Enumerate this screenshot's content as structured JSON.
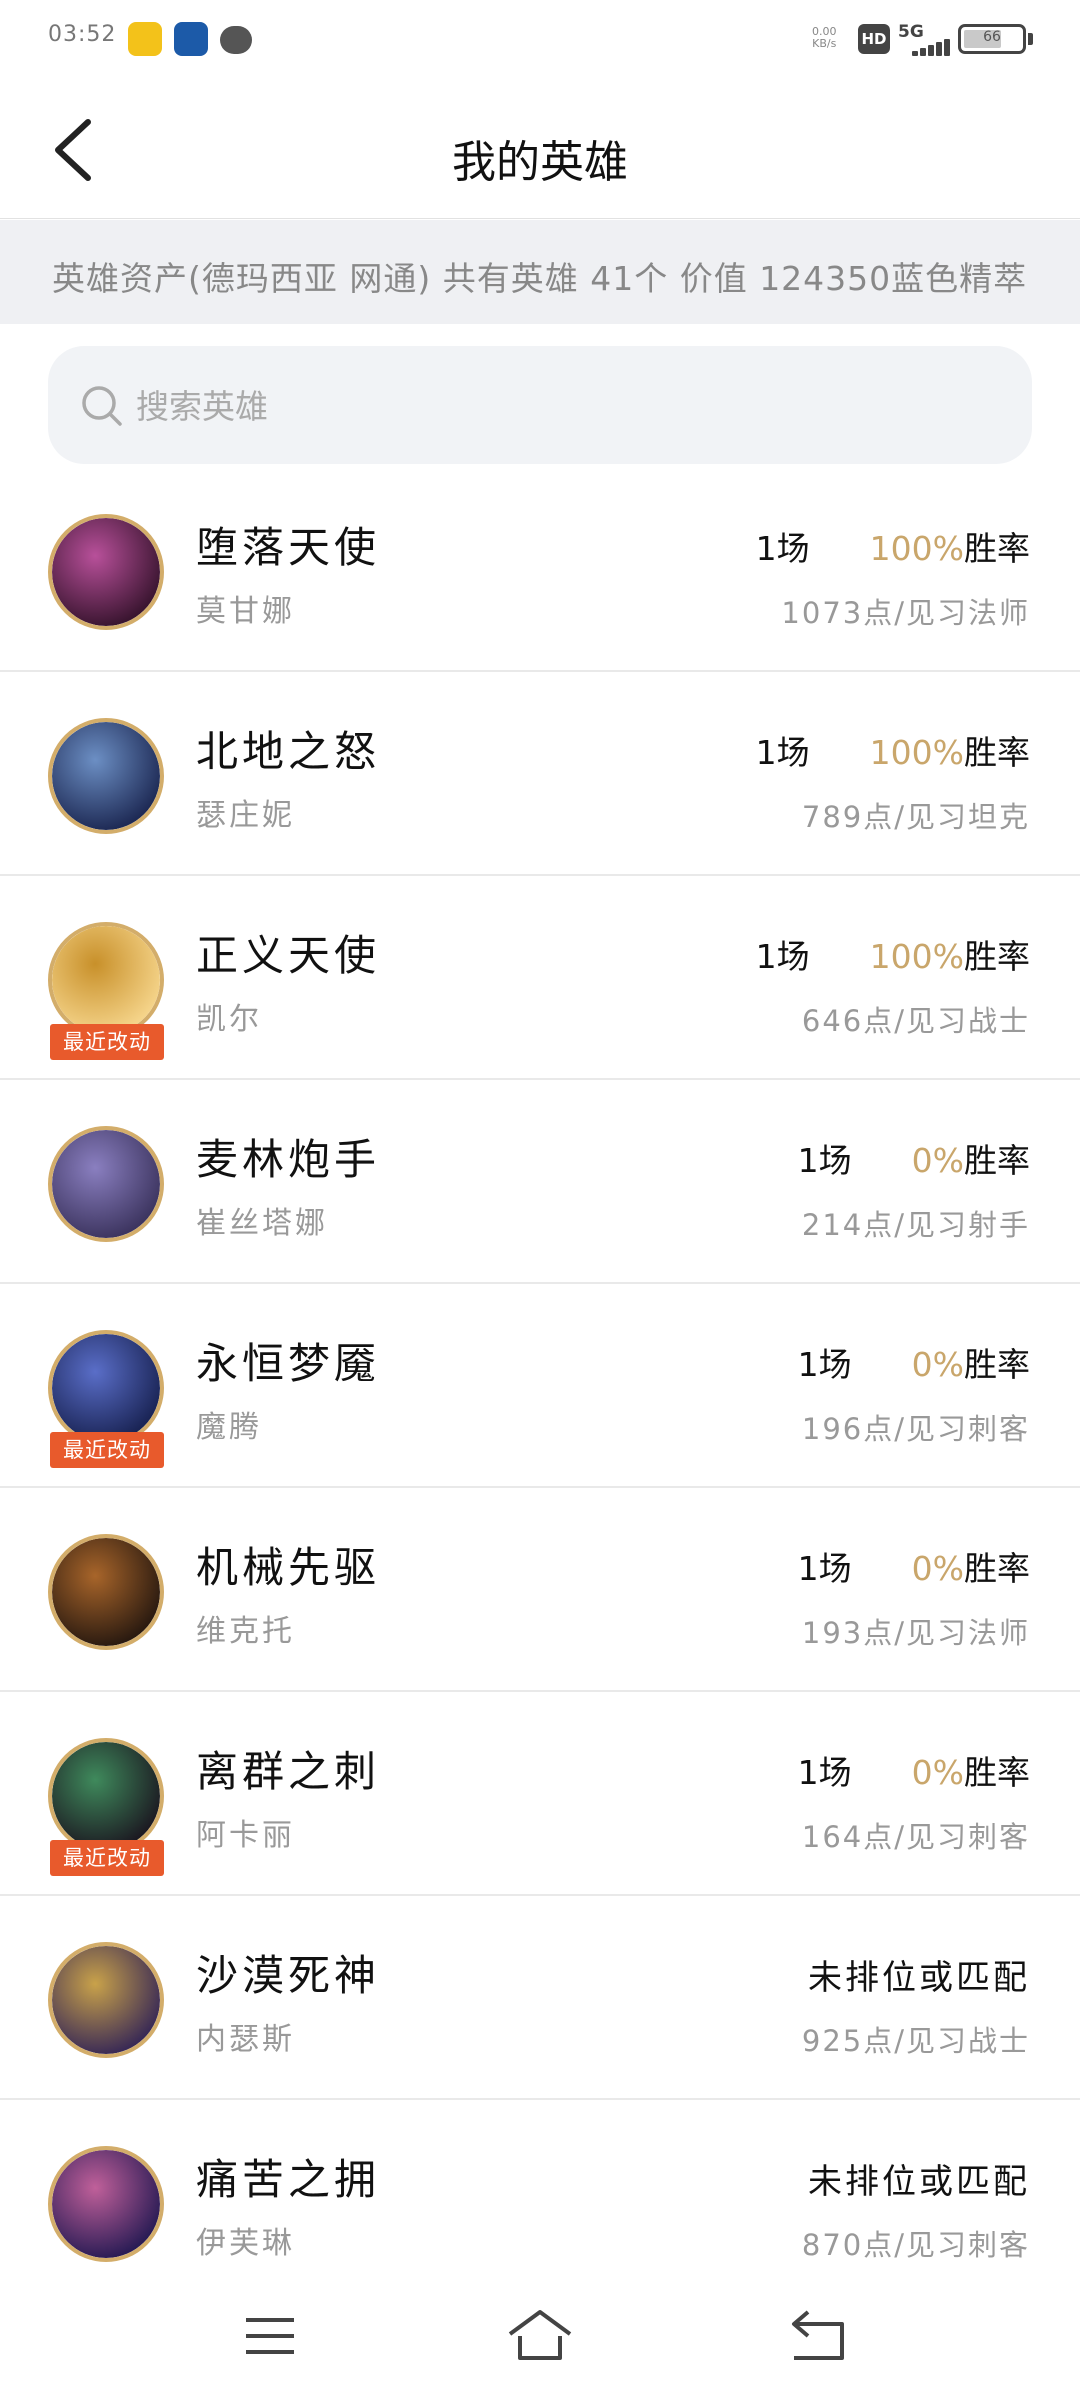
{
  "status_bar": {
    "time": "03:52",
    "net_speed_top": "0.00",
    "net_speed_bottom": "KB/s",
    "hd": "HD",
    "network": "5G",
    "battery": "66"
  },
  "header": {
    "title": "我的英雄",
    "back_icon": "chevron-left-icon"
  },
  "summary": {
    "text": "英雄资产(德玛西亚 网通) 共有英雄 41个 价值 124350蓝色精萃"
  },
  "search": {
    "placeholder": "搜索英雄",
    "value": ""
  },
  "heroes": [
    {
      "title": "堕落天使",
      "name": "莫甘娜",
      "games": "1场",
      "rate": "100%",
      "rate_label": "胜率",
      "points": "1073点/见习法师",
      "badge": "",
      "colors": [
        "#3a1530",
        "#b8509a"
      ]
    },
    {
      "title": "北地之怒",
      "name": "瑟庄妮",
      "games": "1场",
      "rate": "100%",
      "rate_label": "胜率",
      "points": "789点/见习坦克",
      "badge": "",
      "colors": [
        "#1e2a55",
        "#6c8fc4"
      ]
    },
    {
      "title": "正义天使",
      "name": "凯尔",
      "games": "1场",
      "rate": "100%",
      "rate_label": "胜率",
      "points": "646点/见习战士",
      "badge": "最近改动",
      "colors": [
        "#f5d48a",
        "#c8902a"
      ]
    },
    {
      "title": "麦林炮手",
      "name": "崔丝塔娜",
      "games": "1场",
      "rate": "0%",
      "rate_label": "胜率",
      "points": "214点/见习射手",
      "badge": "",
      "colors": [
        "#3d3560",
        "#8a7fc0"
      ]
    },
    {
      "title": "永恒梦魇",
      "name": "魔腾",
      "games": "1场",
      "rate": "0%",
      "rate_label": "胜率",
      "points": "196点/见习刺客",
      "badge": "最近改动",
      "colors": [
        "#1a2455",
        "#5a6ec8"
      ]
    },
    {
      "title": "机械先驱",
      "name": "维克托",
      "games": "1场",
      "rate": "0%",
      "rate_label": "胜率",
      "points": "193点/见习法师",
      "badge": "",
      "colors": [
        "#2a1a10",
        "#a8652a"
      ]
    },
    {
      "title": "离群之刺",
      "name": "阿卡丽",
      "games": "1场",
      "rate": "0%",
      "rate_label": "胜率",
      "points": "164点/见习刺客",
      "badge": "最近改动",
      "colors": [
        "#1c1a22",
        "#3f8a5c"
      ]
    },
    {
      "title": "沙漠死神",
      "name": "内瑟斯",
      "games": "",
      "rate": "",
      "rate_label": "",
      "unranked": "未排位或匹配",
      "points": "925点/见习战士",
      "badge": "",
      "colors": [
        "#3a2a55",
        "#c9a24a"
      ]
    },
    {
      "title": "痛苦之拥",
      "name": "伊芙琳",
      "games": "",
      "rate": "",
      "rate_label": "",
      "unranked": "未排位或匹配",
      "points": "870点/见习刺客",
      "badge": "",
      "colors": [
        "#2a1c55",
        "#c0609a"
      ]
    }
  ],
  "nav": {
    "menu_icon": "menu-icon",
    "home_icon": "home-icon",
    "back_icon": "back-arrow-icon"
  },
  "colors": {
    "accent_gold": "#c9a66b",
    "badge_orange": "#e85a2c",
    "summary_bg": "#eff0f3"
  }
}
